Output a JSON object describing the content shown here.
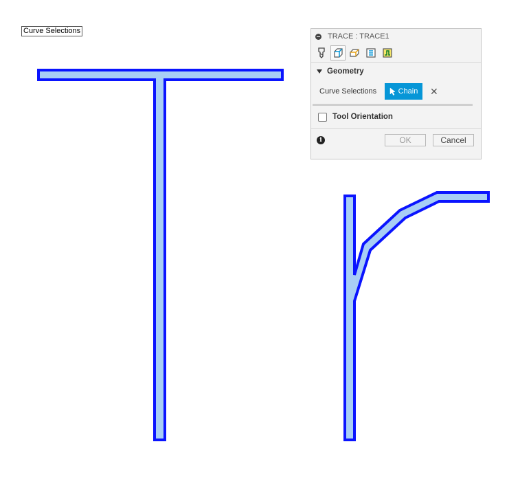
{
  "tooltip": {
    "text": "Curve Selections"
  },
  "dialog": {
    "title": "TRACE : TRACE1",
    "tabs": [
      {
        "icon": "tool-icon"
      },
      {
        "icon": "geometry-icon",
        "active": true
      },
      {
        "icon": "heights-icon"
      },
      {
        "icon": "passes-icon"
      },
      {
        "icon": "linking-icon"
      }
    ],
    "geometry_section": {
      "label": "Geometry",
      "curve_selections_label": "Curve Selections",
      "chain_button_label": "Chain",
      "clear_icon": "close-icon"
    },
    "tool_orientation": {
      "label": "Tool Orientation",
      "checked": false
    },
    "footer": {
      "info_icon": "i",
      "ok_label": "OK",
      "cancel_label": "Cancel"
    }
  },
  "colors": {
    "curve_outline": "#0a14ff",
    "curve_fill": "#a8cef5",
    "accent": "#0696d7"
  }
}
